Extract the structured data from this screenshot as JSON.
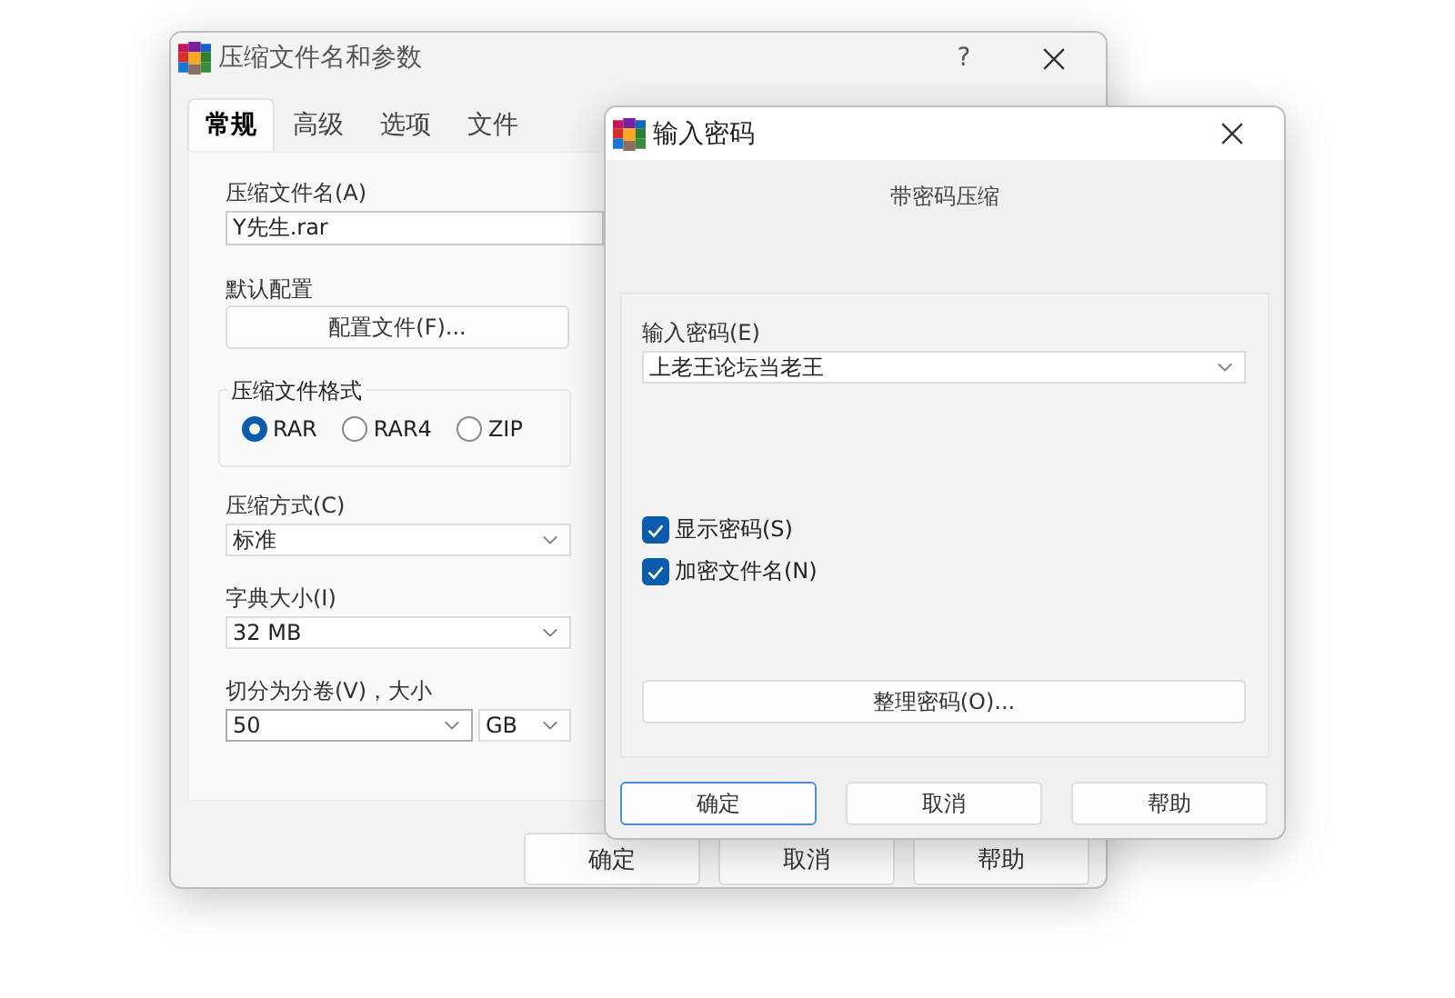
{
  "main_window": {
    "title": "压缩文件名和参数",
    "help_glyph": "?",
    "tabs": [
      {
        "label": "常规",
        "selected": true
      },
      {
        "label": "高级",
        "selected": false
      },
      {
        "label": "选项",
        "selected": false
      },
      {
        "label": "文件",
        "selected": false
      }
    ],
    "archive_name": {
      "label": "压缩文件名(A)",
      "value": "Y先生.rar"
    },
    "default_profile": {
      "label": "默认配置",
      "button": "配置文件(F)..."
    },
    "archive_format": {
      "label": "压缩文件格式",
      "options": [
        {
          "label": "RAR",
          "selected": true
        },
        {
          "label": "RAR4",
          "selected": false
        },
        {
          "label": "ZIP",
          "selected": false
        }
      ]
    },
    "compression_method": {
      "label": "压缩方式(C)",
      "value": "标准"
    },
    "dictionary_size": {
      "label": "字典大小(I)",
      "value": "32 MB"
    },
    "split_volumes": {
      "label": "切分为分卷(V)，大小",
      "value": "50",
      "unit": "GB"
    },
    "buttons": [
      "确定",
      "取消",
      "帮助"
    ]
  },
  "password_dialog": {
    "title": "输入密码",
    "subtitle": "带密码压缩",
    "password": {
      "label": "输入密码(E)",
      "value": "上老王论坛当老王"
    },
    "options": [
      {
        "label": "显示密码(S)",
        "checked": true
      },
      {
        "label": "加密文件名(N)",
        "checked": true
      }
    ],
    "organize_button": "整理密码(O)...",
    "buttons": [
      {
        "label": "确定",
        "focused": true
      },
      {
        "label": "取消",
        "focused": false
      },
      {
        "label": "帮助",
        "focused": false
      }
    ]
  }
}
